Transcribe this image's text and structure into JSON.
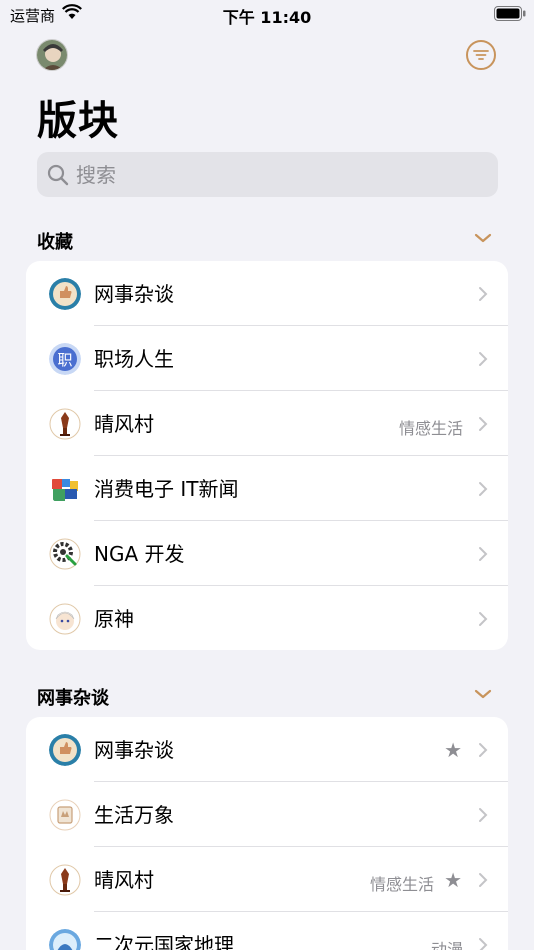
{
  "status_bar": {
    "carrier": "运营商",
    "time": "下午 11:40"
  },
  "header": {
    "title": "版块"
  },
  "search": {
    "placeholder": "搜索"
  },
  "accent_color": "#c8945c",
  "sections": [
    {
      "title": "收藏",
      "items": [
        {
          "label": "网事杂谈",
          "tag": "",
          "starred": false,
          "icon": "forum-icon-thumb"
        },
        {
          "label": "职场人生",
          "tag": "",
          "starred": false,
          "icon": "forum-icon-career"
        },
        {
          "label": "晴风村",
          "tag": "情感生活",
          "starred": false,
          "icon": "forum-icon-village"
        },
        {
          "label": "消费电子 IT新闻",
          "tag": "",
          "starred": false,
          "icon": "forum-icon-electronics"
        },
        {
          "label": "NGA 开发",
          "tag": "",
          "starred": false,
          "icon": "forum-icon-gear"
        },
        {
          "label": "原神",
          "tag": "",
          "starred": false,
          "icon": "forum-icon-genshin"
        }
      ]
    },
    {
      "title": "网事杂谈",
      "items": [
        {
          "label": "网事杂谈",
          "tag": "",
          "starred": true,
          "icon": "forum-icon-thumb"
        },
        {
          "label": "生活万象",
          "tag": "",
          "starred": false,
          "icon": "forum-icon-life"
        },
        {
          "label": "晴风村",
          "tag": "情感生活",
          "starred": true,
          "icon": "forum-icon-village"
        },
        {
          "label": "二次元国家地理",
          "tag": "动漫",
          "starred": false,
          "icon": "forum-icon-anime"
        }
      ]
    }
  ]
}
